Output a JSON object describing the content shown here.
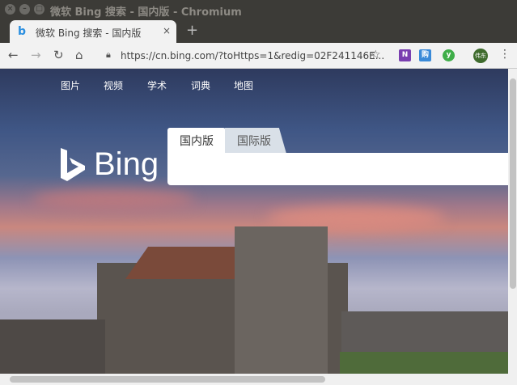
{
  "window": {
    "title": "微软 Bing 搜索 - 国内版 - Chromium"
  },
  "tab": {
    "label": "微软 Bing 搜索 - 国内版",
    "close": "×",
    "favicon": "b"
  },
  "new_tab": "+",
  "toolbar": {
    "back": "←",
    "forward": "→",
    "reload": "↻",
    "home": "⌂",
    "url": "https://cn.bing.com/?toHttps=1&redig=02F241146E...",
    "star": "☆",
    "avatar": "伟东",
    "menu": "⋮"
  },
  "page": {
    "nav": [
      "图片",
      "视频",
      "学术",
      "词典",
      "地图"
    ],
    "logo_text": "Bing",
    "search_tabs": [
      "国内版",
      "国际版"
    ],
    "search_value": ""
  }
}
